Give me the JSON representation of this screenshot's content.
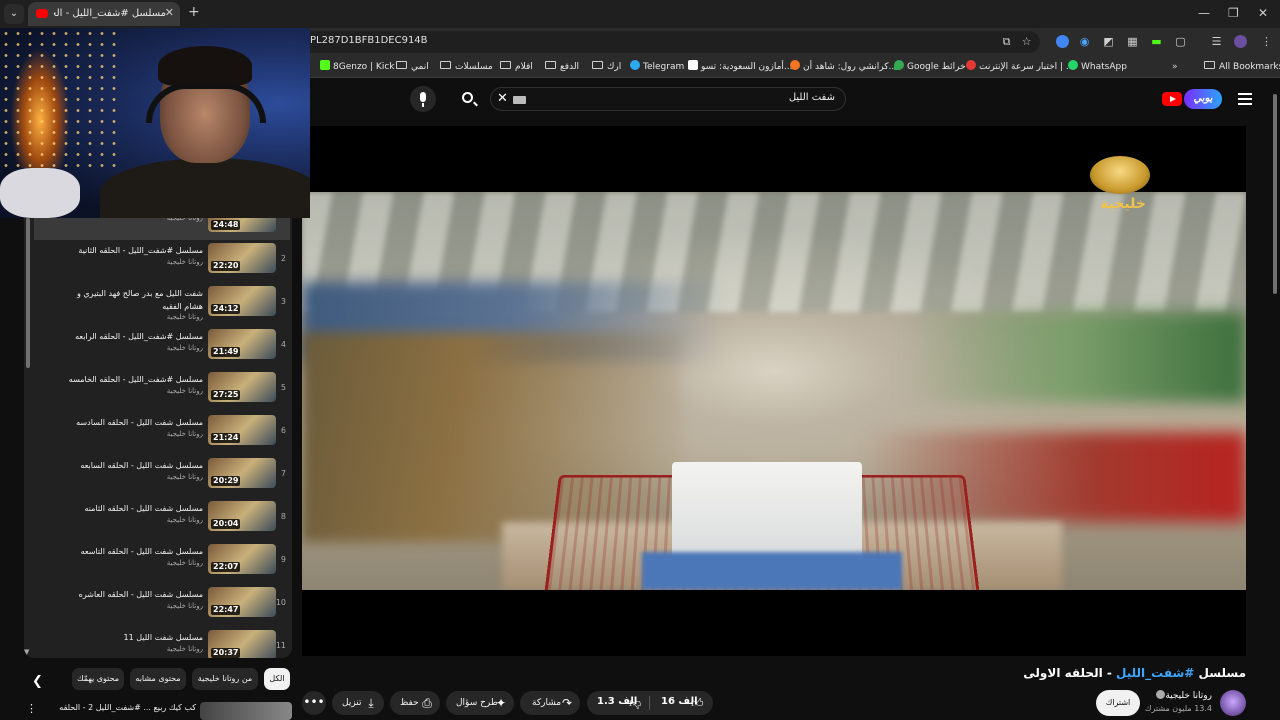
{
  "browser": {
    "tab_title": "مسلسل #شفت_الليل - الحلقه الا",
    "tab_list_label": "⌄",
    "new_tab_label": "+",
    "window_controls": [
      "—",
      "❐",
      "✕"
    ],
    "url": "PL287D1BFB1DEC914B"
  },
  "bookmarks": [
    {
      "label": "8Genzo | Kick",
      "icon_color": "#53fc18",
      "icon": "kick-icon"
    },
    {
      "label": "انمي",
      "icon": "folder-icon"
    },
    {
      "label": "مسلسلات",
      "icon": "folder-icon"
    },
    {
      "label": "افلام",
      "icon": "folder-icon"
    },
    {
      "label": "الدفع",
      "icon": "folder-icon"
    },
    {
      "label": "ارك",
      "icon": "folder-icon"
    },
    {
      "label": "Telegram",
      "icon_color": "#2aabee",
      "icon": "telegram-icon"
    },
    {
      "label": "أمازون السعودية: تسو...",
      "icon_color": "#ffffff",
      "icon": "amazon-icon"
    },
    {
      "label": "كرانشي رول: شاهد أن...",
      "icon_color": "#f47521",
      "icon": "crunchyroll-icon"
    },
    {
      "label": "Google خرائط",
      "icon_color": "#34a853",
      "icon": "maps-icon"
    },
    {
      "label": "اختبار سرعة الإنترنت | ...",
      "icon_color": "#e53935",
      "icon": "speedtest-icon"
    },
    {
      "label": "WhatsApp",
      "icon_color": "#25d366",
      "icon": "whatsapp-icon"
    },
    {
      "label": "All Bookmarks",
      "icon": "folder-icon"
    }
  ],
  "yt": {
    "search_value": "شفت الليل",
    "brand_text": "يوبي"
  },
  "player": {
    "channel_logo_text": "خليجية"
  },
  "video": {
    "title_prefix": "مسلسل ",
    "title_tag": "#شفت_الليل",
    "title_suffix": " - الحلقه الاولى",
    "channel": "روتانا خليجية",
    "subscribers": "13.4 مليون مشترك",
    "subscribe_label": "اشتراك",
    "likes": "16 الف",
    "dislikes": "1.3 الف",
    "share_label": "مشاركة",
    "ask_label": "طرح سؤال",
    "save_label": "حفظ",
    "download_label": "تنزيل",
    "more_label": "•••"
  },
  "playlist": [
    {
      "index": "",
      "title": "",
      "channel": "روتانا خليجية",
      "duration": "24:48"
    },
    {
      "index": "2",
      "title": "مسلسل #شفت_الليل - الحلقه الثانية",
      "channel": "روتانا خليجية",
      "duration": "22:20"
    },
    {
      "index": "3",
      "title": "شفت الليل مع بدر صالح فهد البتيري و هشام الفقيه",
      "channel": "روتانا خليجية",
      "duration": "24:12"
    },
    {
      "index": "4",
      "title": "مسلسل #شفت_الليل - الحلقه الرابعه",
      "channel": "روتانا خليجية",
      "duration": "21:49"
    },
    {
      "index": "5",
      "title": "مسلسل #شفت_الليل - الحلقه الخامسه",
      "channel": "روتانا خليجية",
      "duration": "27:25"
    },
    {
      "index": "6",
      "title": "مسلسل شفت الليل - الحلقه السادسه",
      "channel": "روتانا خليجية",
      "duration": "21:24"
    },
    {
      "index": "7",
      "title": "مسلسل شفت الليل - الحلقه السابعه",
      "channel": "روتانا خليجية",
      "duration": "20:29"
    },
    {
      "index": "8",
      "title": "مسلسل شفت الليل - الحلقه الثامنه",
      "channel": "روتانا خليجية",
      "duration": "20:04"
    },
    {
      "index": "9",
      "title": "مسلسل شفت الليل - الحلقه التاسعه",
      "channel": "روتانا خليجية",
      "duration": "22:07"
    },
    {
      "index": "10",
      "title": "مسلسل شفت الليل - الحلقه العاشره",
      "channel": "روتانا خليجية",
      "duration": "22:47"
    },
    {
      "index": "11",
      "title": "مسلسل شفت الليل 11",
      "channel": "روتانا خليجية",
      "duration": "20:37"
    }
  ],
  "chips": [
    "الكل",
    "من روتانا خليجية",
    "محتوى مشابه",
    "محتوى يهمّك"
  ],
  "recommendation": {
    "title": "كب كيك ربيع ... #شفت_الليل 2 - الحلقه"
  }
}
